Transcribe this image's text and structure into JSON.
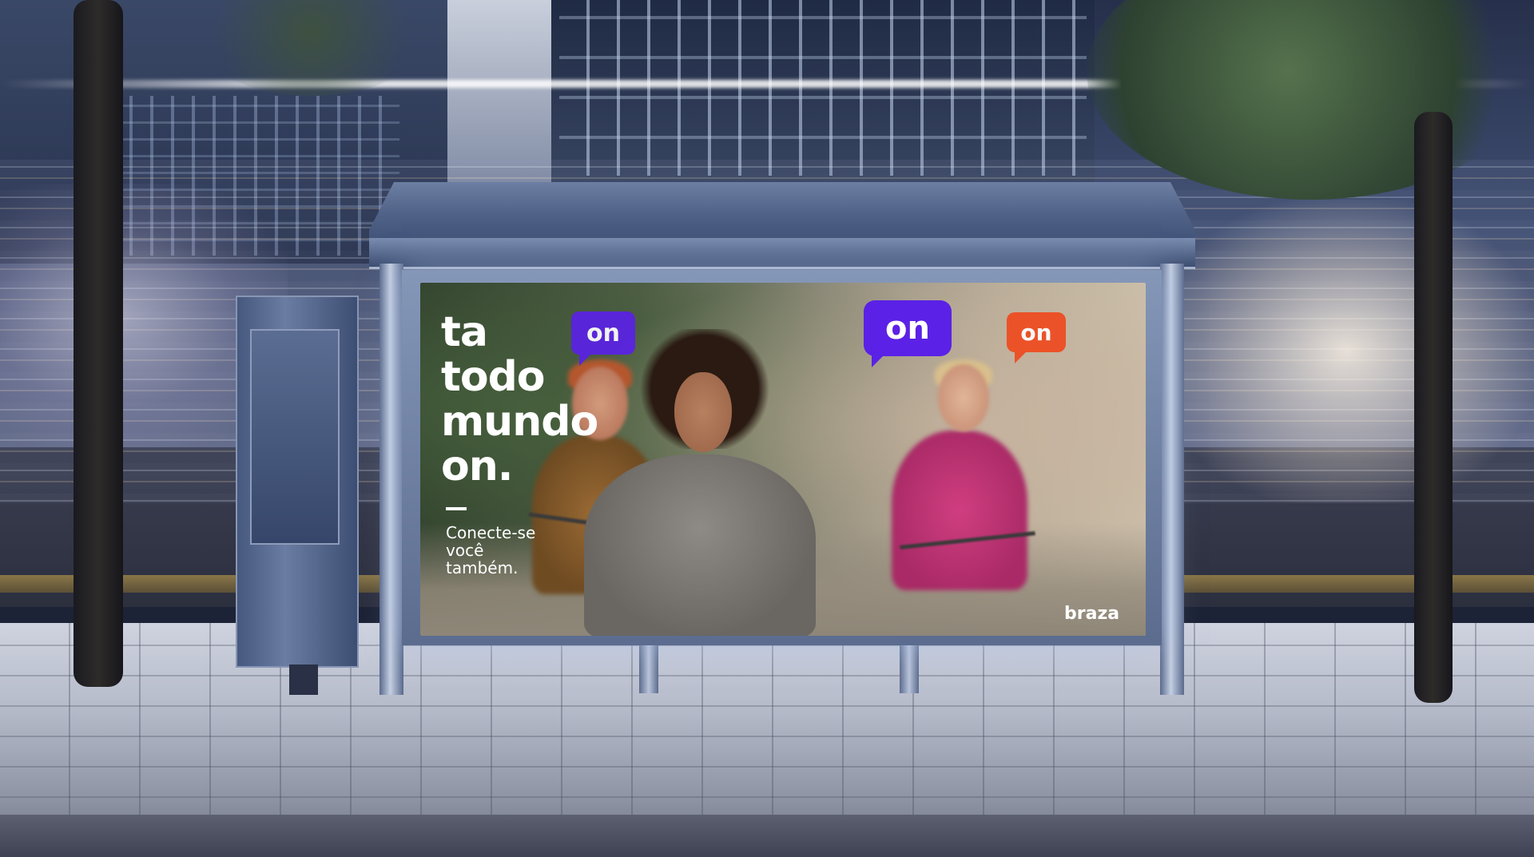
{
  "ad": {
    "headline": [
      "ta",
      "todo",
      "mundo",
      "on."
    ],
    "subcopy": [
      "Conecte-se",
      "você",
      "também."
    ],
    "bubbles": [
      "on",
      "on",
      "on"
    ],
    "brand": "braza"
  },
  "colors": {
    "bubble_purple": "#5b21e6",
    "bubble_orange": "#ef4a1f",
    "headline_text": "#ffffff"
  }
}
